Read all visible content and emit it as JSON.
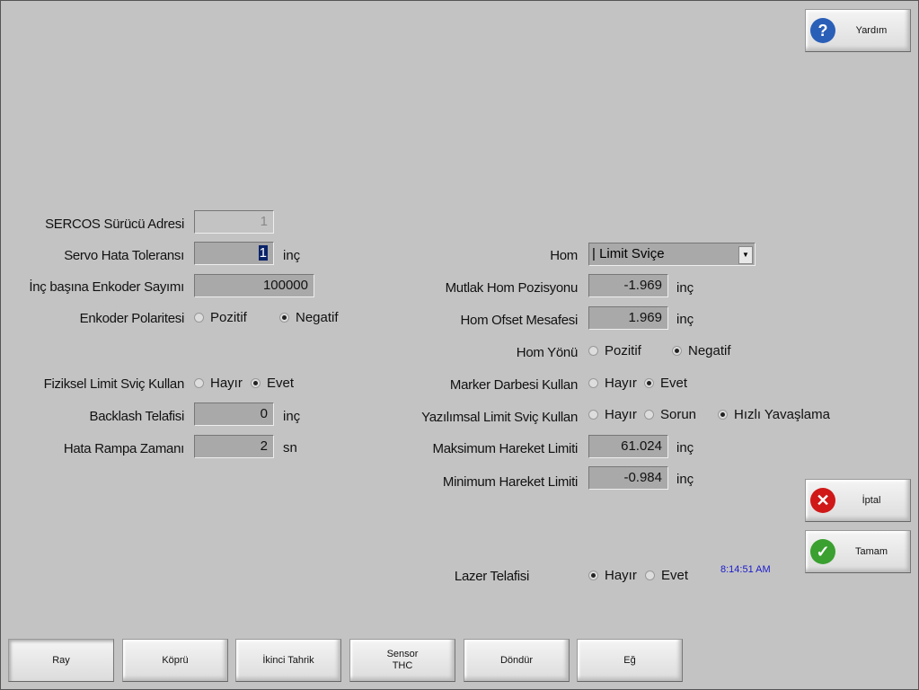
{
  "help_button": {
    "label": "Yardım",
    "icon": "question-icon",
    "color": "#2a5fb8"
  },
  "cancel_button": {
    "label": "İptal",
    "icon": "x-icon",
    "color": "#d01818"
  },
  "ok_button": {
    "label": "Tamam",
    "icon": "check-icon",
    "color": "#3aa030"
  },
  "left": {
    "sercos": {
      "label": "SERCOS Sürücü Adresi",
      "value": "1"
    },
    "servo": {
      "label": "Servo Hata Toleransı",
      "value": "1",
      "unit": "inç"
    },
    "encoder_count": {
      "label": "İnç başına Enkoder Sayımı",
      "value": "100000"
    },
    "encoder_polarity": {
      "label": "Enkoder Polaritesi",
      "opt1": "Pozitif",
      "opt2": "Negatif",
      "selected": "Negatif"
    },
    "phys_limit": {
      "label": "Fiziksel Limit Sviç Kullan",
      "opt1": "Hayır",
      "opt2": "Evet",
      "selected": "Evet"
    },
    "backlash": {
      "label": "Backlash Telafisi",
      "value": "0",
      "unit": "inç"
    },
    "ramp": {
      "label": "Hata Rampa Zamanı",
      "value": "2",
      "unit": "sn"
    }
  },
  "right": {
    "hom": {
      "label": "Hom",
      "value": "| Limit Sviçe"
    },
    "abs_hom": {
      "label": "Mutlak Hom Pozisyonu",
      "value": "-1.969",
      "unit": "inç"
    },
    "hom_offset": {
      "label": "Hom Ofset Mesafesi",
      "value": "1.969",
      "unit": "inç"
    },
    "hom_dir": {
      "label": "Hom Yönü",
      "opt1": "Pozitif",
      "opt2": "Negatif",
      "selected": "Negatif"
    },
    "marker": {
      "label": "Marker Darbesi Kullan",
      "opt1": "Hayır",
      "opt2": "Evet",
      "selected": "Evet"
    },
    "soft_limit": {
      "label": "Yazılımsal Limit Sviç Kullan",
      "opt1": "Hayır",
      "opt2": "Sorun",
      "opt3": "Hızlı Yavaşlama",
      "selected": "Hızlı Yavaşlama"
    },
    "max_limit": {
      "label": "Maksimum Hareket Limiti",
      "value": "61.024",
      "unit": "inç"
    },
    "min_limit": {
      "label": "Minimum Hareket Limiti",
      "value": "-0.984",
      "unit": "inç"
    },
    "laser": {
      "label": "Lazer Telafisi",
      "opt1": "Hayır",
      "opt2": "Evet",
      "selected": "Hayır"
    }
  },
  "time": "8:14:51 AM",
  "tabs": [
    {
      "label": "Ray"
    },
    {
      "label": "Köprü"
    },
    {
      "label": "İkinci Tahrik"
    },
    {
      "label": "Sensor THC"
    },
    {
      "label": "Döndür"
    },
    {
      "label": "Eğ"
    }
  ]
}
